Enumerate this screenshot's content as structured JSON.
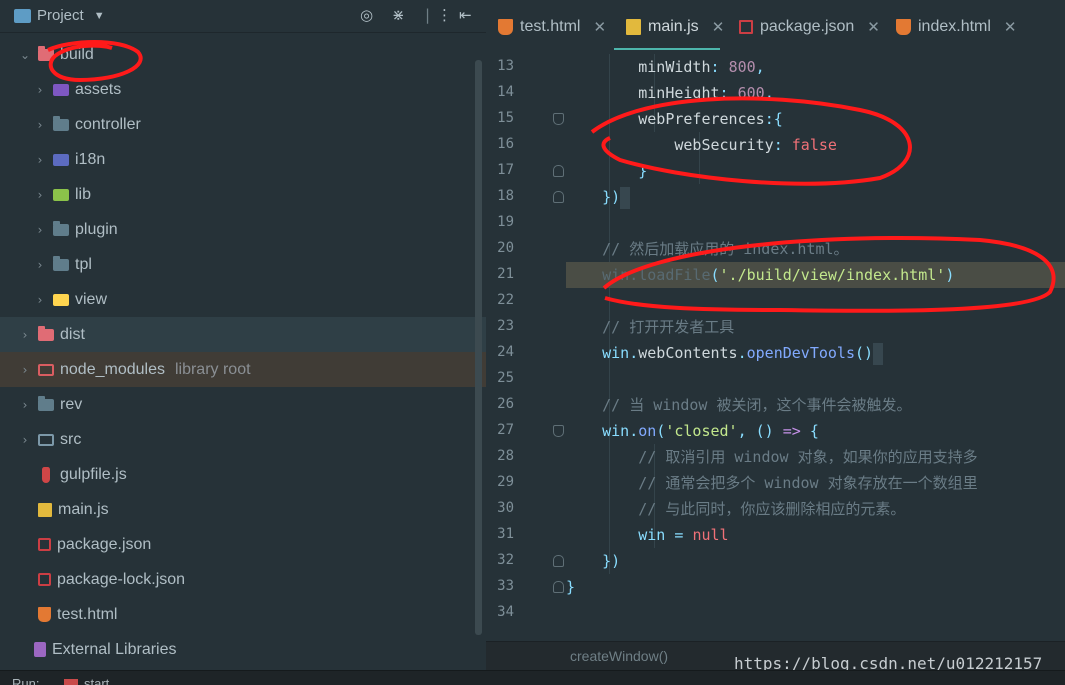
{
  "project_panel": {
    "title": "Project",
    "header_icons": [
      "target-icon",
      "collapse-icon",
      "more-icon",
      "hide-icon"
    ],
    "tree": [
      {
        "label": "build",
        "extra": "",
        "icon": "folder-red",
        "expanded": true,
        "level": 0
      },
      {
        "label": "assets",
        "extra": "",
        "icon": "folder-purple",
        "expanded": false,
        "level": 1
      },
      {
        "label": "controller",
        "extra": "",
        "icon": "folder",
        "expanded": false,
        "level": 1
      },
      {
        "label": "i18n",
        "extra": "",
        "icon": "folder-blue",
        "expanded": false,
        "level": 1
      },
      {
        "label": "lib",
        "extra": "",
        "icon": "folder-green",
        "expanded": false,
        "level": 1
      },
      {
        "label": "plugin",
        "extra": "",
        "icon": "folder",
        "expanded": false,
        "level": 1
      },
      {
        "label": "tpl",
        "extra": "",
        "icon": "folder",
        "expanded": false,
        "level": 1
      },
      {
        "label": "view",
        "extra": "",
        "icon": "folder-yellow",
        "expanded": false,
        "level": 1
      },
      {
        "label": "dist",
        "extra": "",
        "icon": "folder-red",
        "expanded": false,
        "level": 0
      },
      {
        "label": "node_modules",
        "extra": "library root",
        "icon": "folder-outline",
        "expanded": false,
        "level": 0
      },
      {
        "label": "rev",
        "extra": "",
        "icon": "folder",
        "expanded": false,
        "level": 0
      },
      {
        "label": "src",
        "extra": "",
        "icon": "folder-src",
        "expanded": false,
        "level": 0
      },
      {
        "label": "gulpfile.js",
        "extra": "",
        "icon": "file-gulp",
        "expanded": null,
        "level": 0
      },
      {
        "label": "main.js",
        "extra": "",
        "icon": "file-js",
        "expanded": null,
        "level": 0
      },
      {
        "label": "package.json",
        "extra": "",
        "icon": "file-json",
        "expanded": null,
        "level": 0
      },
      {
        "label": "package-lock.json",
        "extra": "",
        "icon": "file-json",
        "expanded": null,
        "level": 0
      },
      {
        "label": "test.html",
        "extra": "",
        "icon": "file-html",
        "expanded": null,
        "level": 0
      },
      {
        "label": "External Libraries",
        "extra": "",
        "icon": "ext-lib",
        "expanded": null,
        "level": -1
      }
    ]
  },
  "editor": {
    "tabs": [
      {
        "label": "test.html",
        "icon": "html",
        "active": false
      },
      {
        "label": "main.js",
        "icon": "js",
        "active": true
      },
      {
        "label": "package.json",
        "icon": "json",
        "active": false
      },
      {
        "label": "index.html",
        "icon": "html",
        "active": false
      }
    ],
    "lines": [
      {
        "n": "13"
      },
      {
        "n": "14"
      },
      {
        "n": "15"
      },
      {
        "n": "16"
      },
      {
        "n": "17"
      },
      {
        "n": "18"
      },
      {
        "n": "19"
      },
      {
        "n": "20"
      },
      {
        "n": "21"
      },
      {
        "n": "22"
      },
      {
        "n": "23"
      },
      {
        "n": "24"
      },
      {
        "n": "25"
      },
      {
        "n": "26"
      },
      {
        "n": "27"
      },
      {
        "n": "28"
      },
      {
        "n": "29"
      },
      {
        "n": "30"
      },
      {
        "n": "31"
      },
      {
        "n": "32"
      },
      {
        "n": "33"
      },
      {
        "n": "34"
      }
    ],
    "code": {
      "l13_prop": "minWidth",
      "l13_val": "800",
      "l14_prop": "minHeight",
      "l14_val": "600",
      "l15_prop": "webPreferences",
      "l16_prop": "webSecurity",
      "l16_val": "false",
      "l20_cmt": "// 然后加载应用的 index.html。",
      "l21_obj": "win",
      "l21_fn": "loadFile",
      "l21_str": "'./build/view/index.html'",
      "l23_cmt": "// 打开开发者工具",
      "l24_obj": "win",
      "l24_prop": "webContents",
      "l24_fn": "openDevTools",
      "l26_cmt": "// 当 window 被关闭，这个事件会被触发。",
      "l27_obj": "win",
      "l27_fn": "on",
      "l27_str": "'closed'",
      "l28_cmt": "// 取消引用 window 对象，如果你的应用支持多",
      "l29_cmt": "// 通常会把多个 window 对象存放在一个数组里",
      "l30_cmt": "// 与此同时，你应该删除相应的元素。",
      "l31_var": "win",
      "l31_val": "null"
    },
    "breadcrumb": "createWindow()"
  },
  "watermark": "https://blog.csdn.net/u012212157",
  "run_strip": {
    "label": "Run:",
    "tab": "start"
  },
  "annotation_color": "#ff1a1a"
}
